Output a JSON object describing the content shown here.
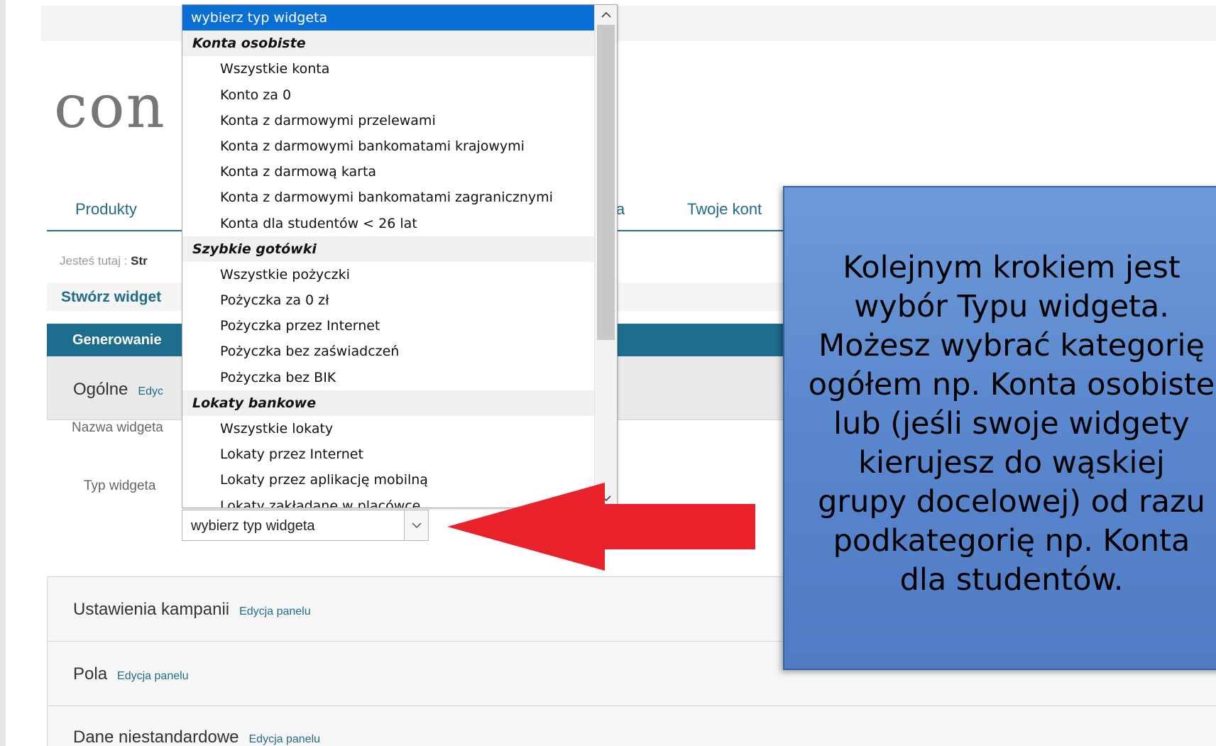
{
  "logo": {
    "text": "con"
  },
  "nav": {
    "items": [
      "Produkty",
      "ia",
      "Twoje kont"
    ]
  },
  "breadcrumb": {
    "label": "Jesteś tutaj :",
    "current": "Str"
  },
  "create_title": "Stwórz widget",
  "generate_bar": "Generowanie",
  "panels": {
    "general": {
      "title": "Ogólne",
      "edit": "Edyc"
    },
    "campaign": {
      "title": "Ustawienia kampanii",
      "edit": "Edycja panelu"
    },
    "fields": {
      "title": "Pola",
      "edit": "Edycja panelu"
    },
    "custom": {
      "title": "Dane niestandardowe",
      "edit": "Edycja panelu"
    }
  },
  "form": {
    "name_label": "Nazwa widgeta",
    "type_label": "Typ widgeta",
    "type_value": "wybierz typ widgeta"
  },
  "dropdown": {
    "selected": "wybierz typ widgeta",
    "groups": [
      {
        "label": "Konta osobiste",
        "options": [
          "Wszystkie konta",
          "Konto za 0",
          "Konta z darmowymi przelewami",
          "Konta z darmowymi bankomatami krajowymi",
          "Konta z darmową karta",
          "Konta z darmowymi bankomatami zagranicznymi",
          "Konta dla studentów < 26 lat"
        ]
      },
      {
        "label": "Szybkie gotówki",
        "options": [
          "Wszystkie pożyczki",
          "Pożyczka za 0 zł",
          "Pożyczka przez Internet",
          "Pożyczka bez zaświadczeń",
          "Pożyczka bez BIK"
        ]
      },
      {
        "label": "Lokaty bankowe",
        "options": [
          "Wszystkie lokaty",
          "Lokaty przez Internet",
          "Lokaty przez aplikację mobilną",
          "Lokaty zakładane w placówce"
        ]
      }
    ]
  },
  "callout": {
    "lines": [
      "Kolejnym krokiem jest",
      "wybór Typu widgeta.",
      "Możesz wybrać kategorię",
      "ogółem np. Konta osobiste",
      "lub (jeśli swoje widgety",
      "kierujesz do wąskiej",
      "grupy docelowej) od razu",
      "podkategorię np. Konta",
      "dla studentów."
    ]
  },
  "colors": {
    "accent": "#1f6c88",
    "selection": "#0a6fd4",
    "callout": "#5885cc",
    "arrow": "#e8212b"
  }
}
